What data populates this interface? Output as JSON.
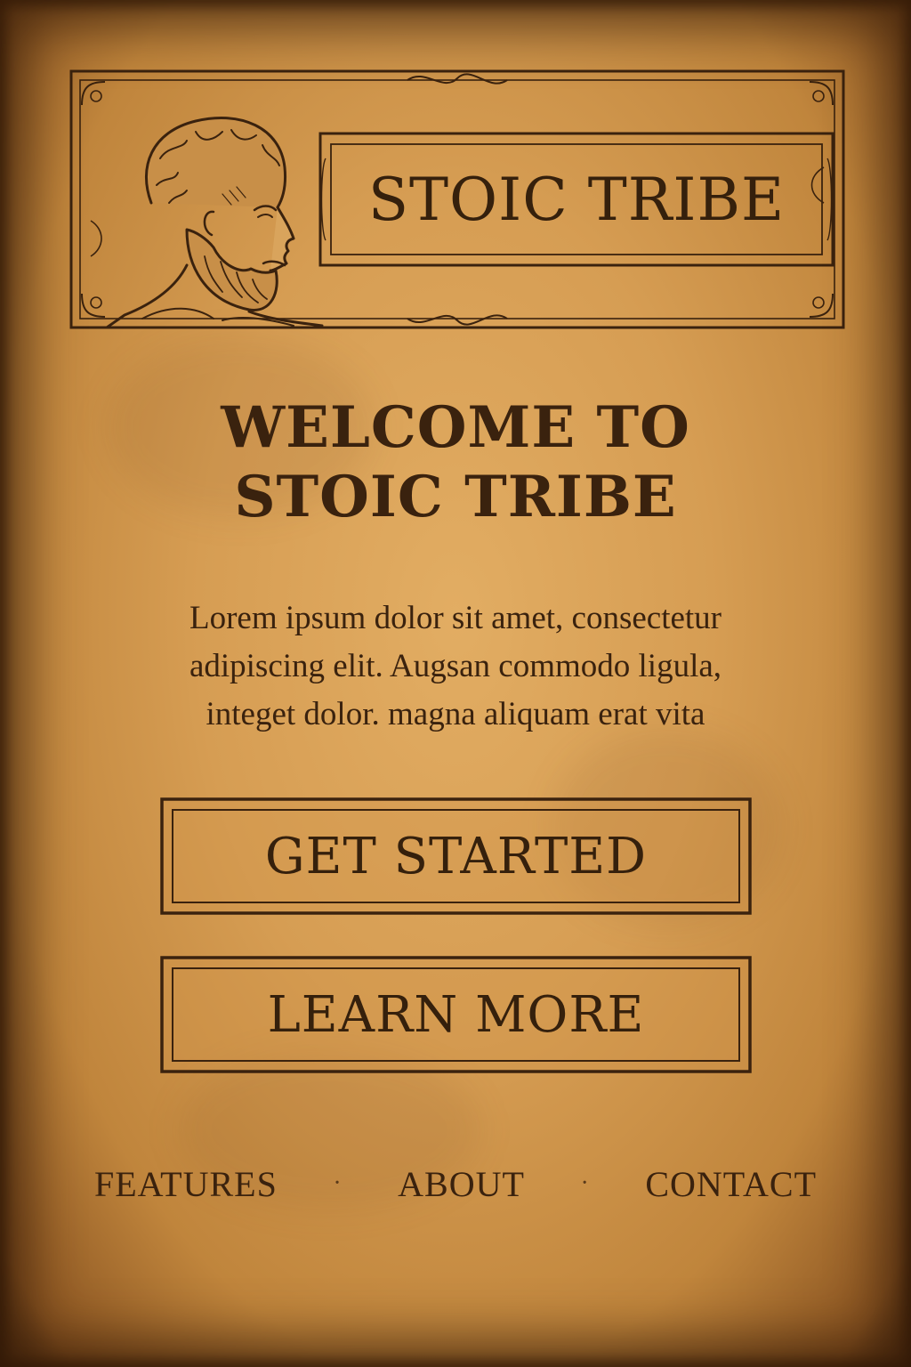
{
  "header": {
    "logo_text": "STOIC TRIBE",
    "bust_icon": "philosopher-bust-icon"
  },
  "hero": {
    "title_line1": "WELCOME TO",
    "title_line2": "STOIC TRIBE",
    "body_line1": "Lorem ipsum dolor sit amet, consectetur",
    "body_line2": "adipiscing elit. Augsan commodo ligula,",
    "body_line3": "integet dolor. magna aliquam erat vita"
  },
  "buttons": {
    "get_started": "GET STARTED",
    "learn_more": "LEARN MORE"
  },
  "footer": {
    "features": "FEATURES",
    "about": "ABOUT",
    "contact": "CONTACT",
    "separator": "·"
  },
  "colors": {
    "ink": "#3a220e",
    "parchment": "#d69d53",
    "edge": "#4a2a10"
  }
}
